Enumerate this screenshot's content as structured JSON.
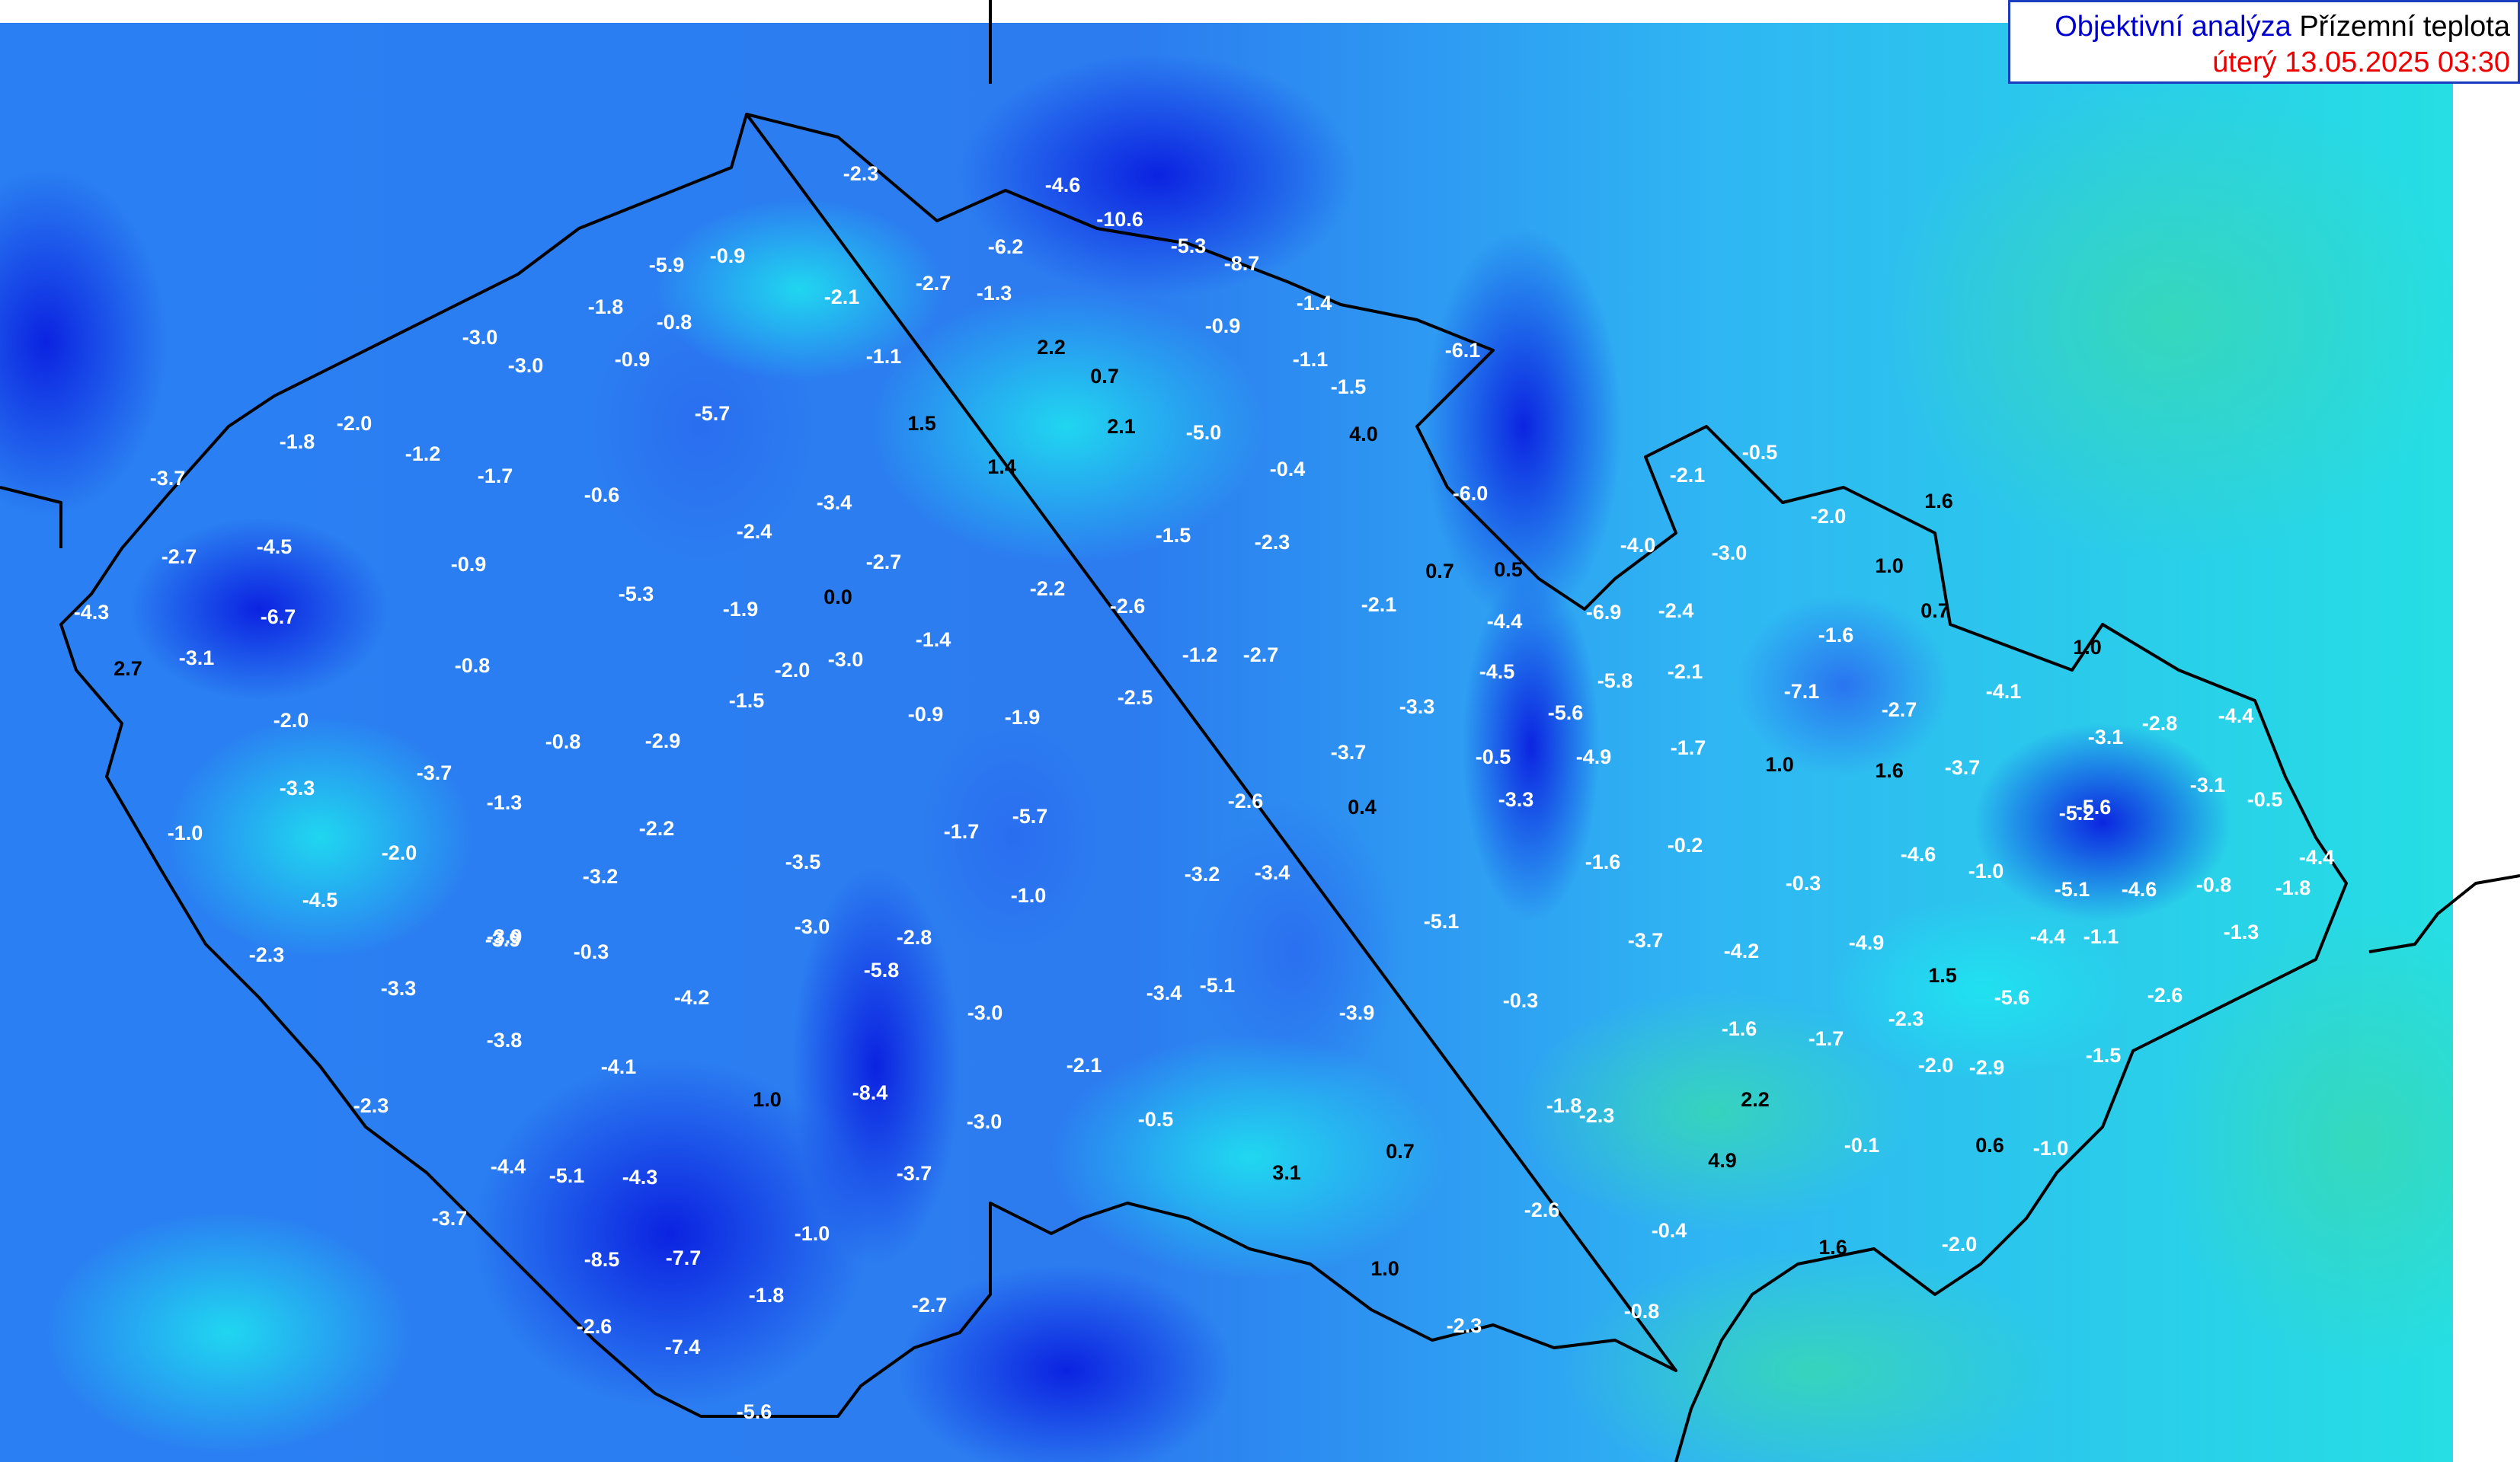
{
  "header": {
    "product_label": "Objektivní analýza",
    "variable_label": "Přízemní teplota",
    "valid_time": "úterý 13.05.2025 03:30"
  },
  "colors": {
    "product_label": "#0000cc",
    "variable_label": "#000000",
    "valid_time": "#ee0000",
    "legend_border": "#1a3cc0",
    "border_line": "#000000",
    "field_deep_blue": "#0a1ee0",
    "field_blue": "#2a6cf0",
    "field_light_blue": "#3aa8f5",
    "field_cyan": "#1ee6f0",
    "field_teal_green": "#38d9b4",
    "label_warm": "#000000",
    "label_cold": "#ffffff"
  },
  "map": {
    "country": "Czech Republic",
    "field": "surface temperature analysis",
    "unit": "°C",
    "values": [
      "-2.3",
      "-4.6",
      "-6.2",
      "-10.6",
      "-5.3",
      "-8.7",
      "-1.4",
      "-5.9",
      "-0.9",
      "-2.1",
      "-2.7",
      "-1.3",
      "-1.8",
      "-0.8",
      "2.2",
      "-0.9",
      "-1.1",
      "-6.1",
      "-3.0",
      "-3.0",
      "-0.9",
      "-1.1",
      "0.7",
      "-1.5",
      "-5.7",
      "1.5",
      "2.1",
      "-5.0",
      "4.0",
      "-2.0",
      "-1.8",
      "-1.2",
      "-1.7",
      "1.4",
      "-0.4",
      "-0.5",
      "-3.7",
      "-0.6",
      "-3.4",
      "-6.0",
      "-2.1",
      "-2.0",
      "1.6",
      "-4.5",
      "-2.7",
      "-0.9",
      "-2.4",
      "-2.7",
      "-1.5",
      "-2.3",
      "-4.0",
      "-3.0",
      "1.0",
      "0.7",
      "0.5",
      "-5.3",
      "0.0",
      "-2.2",
      "-2.6",
      "-2.1",
      "-4.3",
      "-6.7",
      "-1.9",
      "-4.4",
      "-6.9",
      "-2.4",
      "0.7",
      "-3.1",
      "-0.8",
      "-2.0",
      "-3.0",
      "-1.4",
      "-1.2",
      "-2.7",
      "-1.6",
      "1.0",
      "2.7",
      "-1.5",
      "-2.5",
      "-4.5",
      "-5.8",
      "-2.1",
      "-7.1",
      "-4.1",
      "-0.9",
      "-1.9",
      "-3.3",
      "-5.6",
      "-2.7",
      "-2.8",
      "-4.4",
      "-2.0",
      "-2.9",
      "-0.8",
      "-3.7",
      "-0.5",
      "-4.9",
      "-1.7",
      "1.0",
      "1.6",
      "-3.7",
      "-3.1",
      "-3.3",
      "-3.7",
      "-2.6",
      "-3.3",
      "0.4",
      "-3.1",
      "-0.5",
      "-1.3",
      "-5.7",
      "-5.2",
      "-5.6",
      "-1.0",
      "-2.2",
      "-1.7",
      "-1.6",
      "-0.2",
      "-4.6",
      "-4.4",
      "-2.0",
      "-3.5",
      "-3.2",
      "-3.4",
      "-1.0",
      "-0.3",
      "-1.0",
      "-5.1",
      "-4.6",
      "-0.8",
      "-1.8",
      "-3.2",
      "-4.5",
      "-3.0",
      "-2.8",
      "-3.9",
      "-5.1",
      "-3.7",
      "-4.2",
      "-4.9",
      "-4.4",
      "-1.1",
      "-1.3",
      "-2.3",
      "-3.9",
      "-0.3",
      "-5.8",
      "1.5",
      "-3.3",
      "-4.2",
      "-3.0",
      "-3.4",
      "-5.1",
      "-3.9",
      "-0.3",
      "-5.6",
      "-2.6",
      "-3.8",
      "-1.6",
      "-1.7",
      "-2.3",
      "-4.1",
      "-2.1",
      "-2.0",
      "-2.9",
      "-1.5",
      "-2.3",
      "1.0",
      "-8.4",
      "-1.8",
      "-2.3",
      "2.2",
      "-3.0",
      "-0.5",
      "-0.1",
      "0.6",
      "-1.0",
      "-4.4",
      "-5.1",
      "-4.3",
      "-3.7",
      "3.1",
      "0.7",
      "4.9",
      "-3.7",
      "-2.6",
      "-1.0",
      "-0.4",
      "1.6",
      "-2.0",
      "-8.5",
      "-7.7",
      "1.0",
      "-1.8",
      "-2.7",
      "-2.3",
      "-0.8",
      "-2.6",
      "-7.4",
      "-5.6"
    ]
  }
}
